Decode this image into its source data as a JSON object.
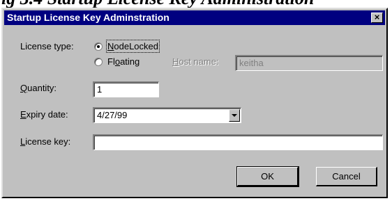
{
  "document": {
    "heading_fragment": "ig 3.4 Startup License Key Administration"
  },
  "dialog": {
    "title": "Startup License Key Adminstration",
    "close_label": "×",
    "license_type": {
      "label_prefix": "",
      "label_u": "",
      "label_rest": "License type:",
      "options": [
        {
          "label_u": "N",
          "label_rest": "odeLocked",
          "checked": true
        },
        {
          "label_pre": "Fl",
          "label_u": "o",
          "label_rest": "ating",
          "checked": false
        }
      ]
    },
    "host_name": {
      "label_u": "H",
      "label_rest": "ost name:",
      "value": "keitha"
    },
    "quantity": {
      "label_u": "Q",
      "label_rest": "uantity:",
      "value": "1"
    },
    "expiry_date": {
      "label_u": "E",
      "label_rest": "xpiry date:",
      "value": "4/27/99"
    },
    "license_key": {
      "label_u": "L",
      "label_rest": "icense key:",
      "value": ""
    },
    "buttons": {
      "ok": "OK",
      "cancel": "Cancel"
    }
  }
}
